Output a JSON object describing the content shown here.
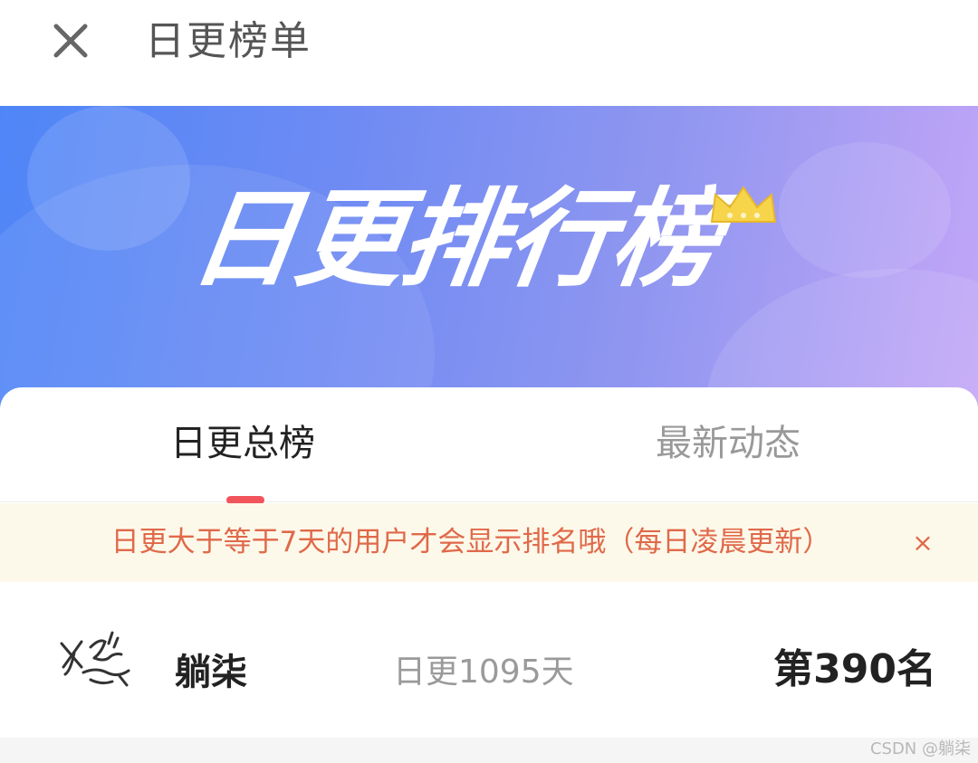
{
  "header": {
    "title": "日更榜单",
    "close_icon": "close-icon"
  },
  "banner": {
    "title": "日更排行榜",
    "crown_icon": "crown-icon",
    "crown_color": "#f7d54a"
  },
  "tabs": [
    {
      "label": "日更总榜",
      "active": true
    },
    {
      "label": "最新动态",
      "active": false
    }
  ],
  "notice": {
    "text": "日更大于等于7天的用户才会显示排名哦（每日凌晨更新）",
    "close_label": "×"
  },
  "ranking": {
    "user": {
      "name": "躺柒",
      "days_text": "日更1095天",
      "rank_text": "第390名"
    }
  },
  "watermark": "CSDN @躺柒",
  "colors": {
    "accent": "#f2545b",
    "notice_text": "#e0694a",
    "notice_bg": "#fdf9ea"
  }
}
